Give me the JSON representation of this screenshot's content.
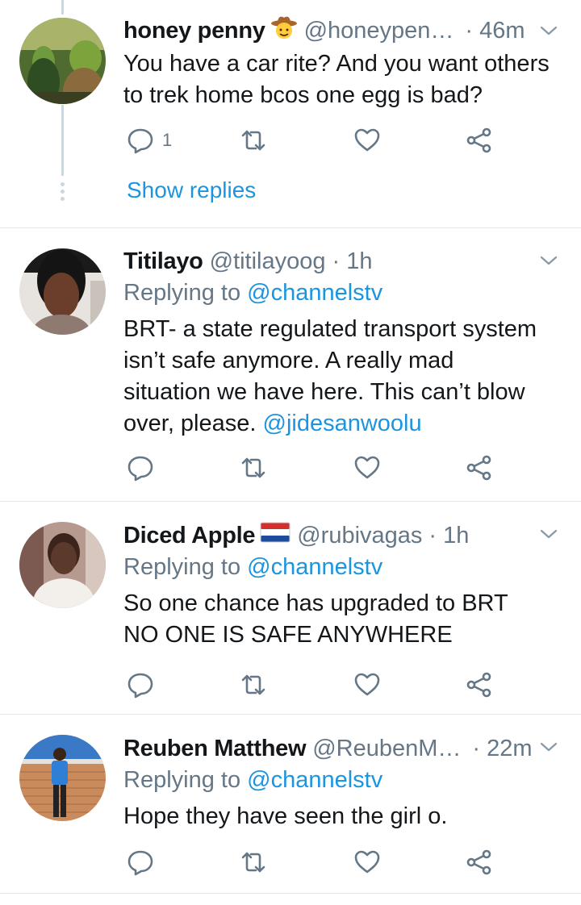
{
  "colors": {
    "accent": "#1b95e0",
    "muted": "#657786",
    "divider": "#e1e8ed"
  },
  "tweets": [
    {
      "name": "honey penny",
      "emoji": "cowboy-face-emoji",
      "handle": "@honeypen…",
      "time": "· 46m",
      "replying_prefix": "",
      "replying_handle": "",
      "text": [
        "You have a car rite? And you want others",
        "to trek home bcos one egg is bad?"
      ],
      "reply_count": "1",
      "show_replies": "Show replies"
    },
    {
      "name": "Titilayo",
      "handle": "@titilayoog",
      "time": "· 1h",
      "replying_prefix": "Replying to",
      "replying_handle": "@channelstv",
      "text": [
        "BRT- a state regulated transport system",
        "isn’t safe anymore. A really mad",
        "situation we have here. This can’t blow"
      ],
      "text_last": "over, please.",
      "mention": "@jidesanwoolu"
    },
    {
      "name": "Diced Apple",
      "emoji": "netherlands-flag-emoji",
      "handle": "@rubivagas",
      "time": "· 1h",
      "replying_prefix": "Replying to",
      "replying_handle": "@channelstv",
      "text": [
        "So one chance has upgraded to BRT",
        "NO ONE IS SAFE ANYWHERE"
      ]
    },
    {
      "name": "Reuben Matthew",
      "handle": "@ReubenM…",
      "time": "· 22m",
      "replying_prefix": "Replying to",
      "replying_handle": "@channelstv",
      "text": [
        "Hope they have seen the girl o."
      ]
    }
  ],
  "icons": {
    "reply": "reply-icon",
    "retweet": "retweet-icon",
    "like": "heart-icon",
    "share": "share-icon",
    "menu": "chevron-down-icon"
  }
}
